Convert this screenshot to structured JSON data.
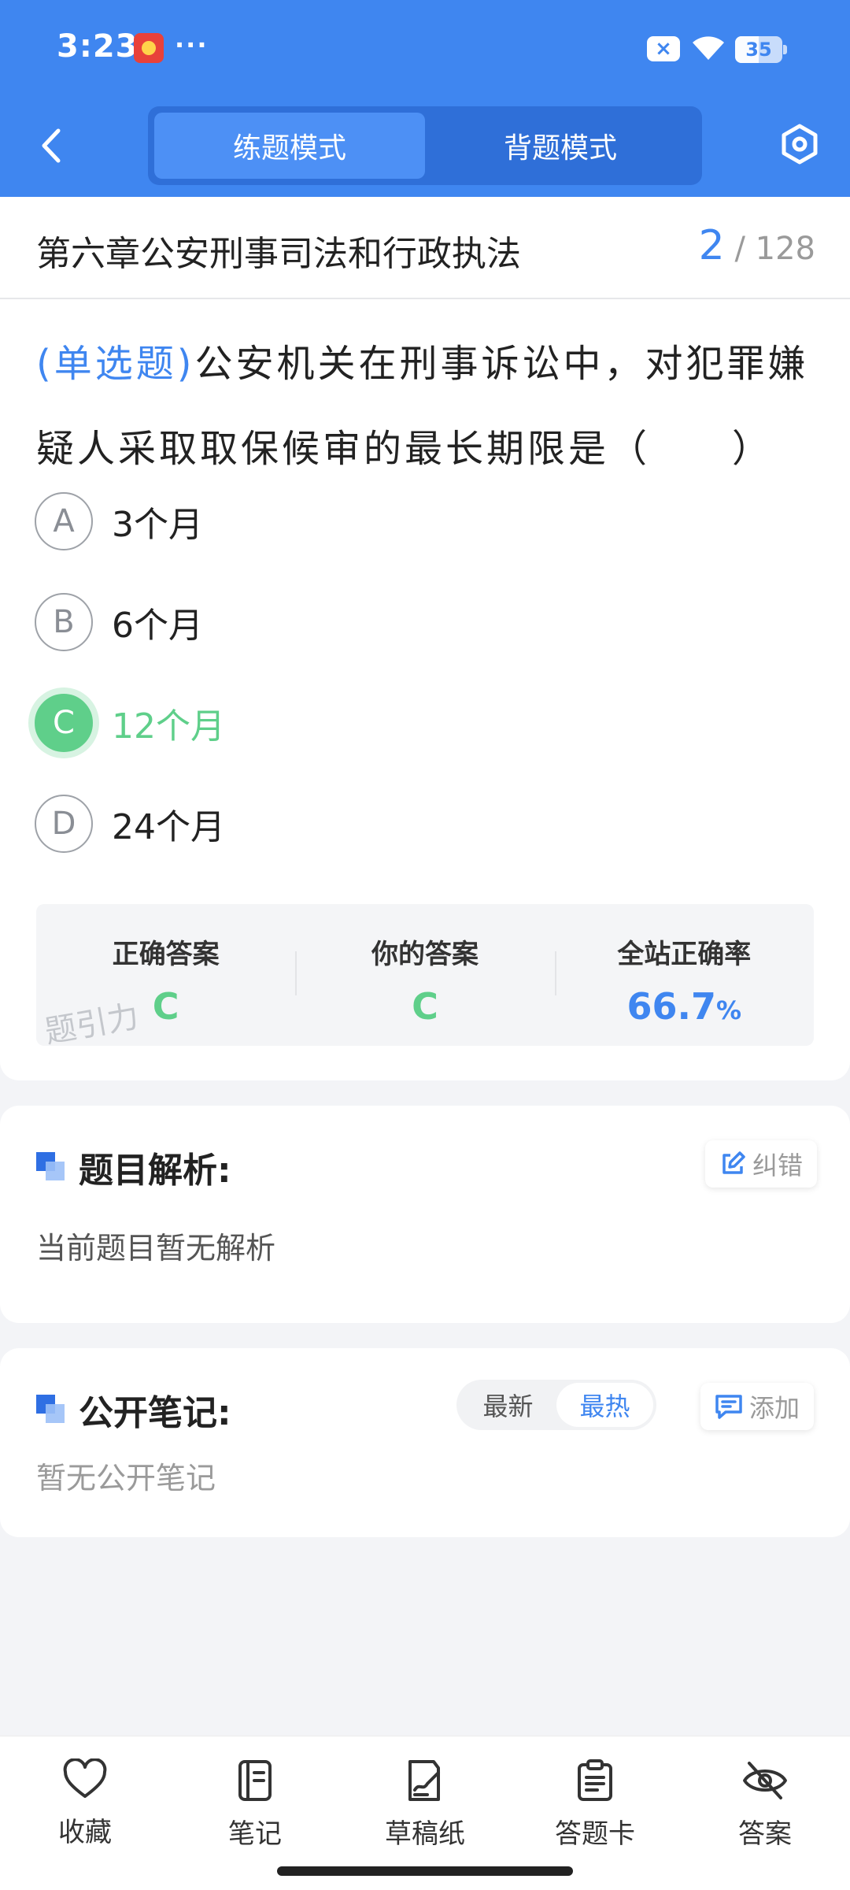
{
  "status_bar": {
    "time": "3:23",
    "dots": "···",
    "battery": "35"
  },
  "nav": {
    "modes": [
      "练题模式",
      "背题模式"
    ],
    "active_mode": "练题模式"
  },
  "chapter": {
    "title": "第六章公安刑事司法和行政执法",
    "current": "2",
    "separator": "/",
    "total": "128"
  },
  "question": {
    "type": "(单选题)",
    "text": "公安机关在刑事诉讼中，对犯罪嫌疑人采取取保候审的最长期限是（　　）",
    "options": [
      {
        "letter": "A",
        "text": "3个月"
      },
      {
        "letter": "B",
        "text": "6个月"
      },
      {
        "letter": "C",
        "text": "12个月"
      },
      {
        "letter": "D",
        "text": "24个月"
      }
    ],
    "correct_letter": "C"
  },
  "answer_summary": {
    "correct_label": "正确答案",
    "correct_value": "C",
    "yours_label": "你的答案",
    "yours_value": "C",
    "rate_label": "全站正确率",
    "rate_value": "66.7",
    "rate_unit": "%",
    "watermark": "题引力"
  },
  "analysis": {
    "title": "题目解析:",
    "report_label": "纠错",
    "text": "当前题目暂无解析"
  },
  "notes": {
    "title": "公开笔记:",
    "sort_options": [
      "最新",
      "最热"
    ],
    "active_sort": "最热",
    "add_label": "添加",
    "empty_text": "暂无公开笔记"
  },
  "bottom_bar": [
    {
      "label": "收藏",
      "icon": "heart-icon"
    },
    {
      "label": "笔记",
      "icon": "notebook-icon"
    },
    {
      "label": "草稿纸",
      "icon": "draft-paper-icon"
    },
    {
      "label": "答题卡",
      "icon": "answer-sheet-icon"
    },
    {
      "label": "答案",
      "icon": "eye-off-icon"
    }
  ],
  "colors": {
    "primary": "#3f86f0",
    "correct": "#5fcf8a"
  }
}
